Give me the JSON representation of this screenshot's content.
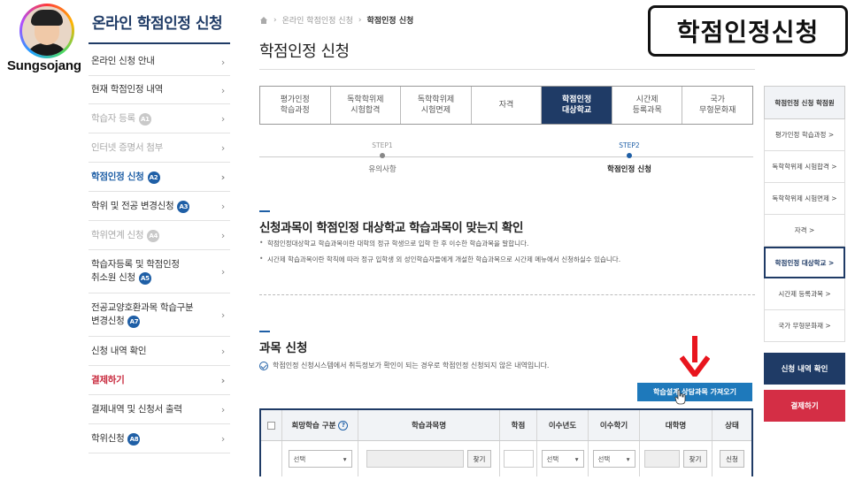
{
  "overlay": {
    "brand": "Sungsojang",
    "caption": "학점인정신청"
  },
  "sidebar": {
    "title": "온라인 학점인정 신청",
    "items": [
      {
        "label": "온라인 신청 안내",
        "badge": "",
        "state": "normal"
      },
      {
        "label": "현재 학점인정 내역",
        "badge": "",
        "state": "normal"
      },
      {
        "label": "학습자 등록",
        "badge": "A1",
        "state": "muted"
      },
      {
        "label": "인터넷 증명서 첨부",
        "badge": "",
        "state": "muted"
      },
      {
        "label": "학점인정 신청",
        "badge": "A2",
        "state": "active"
      },
      {
        "label": "학위 및 전공 변경신청",
        "badge": "A3",
        "state": "normal"
      },
      {
        "label": "학위연계 신청",
        "badge": "A4",
        "state": "muted"
      },
      {
        "label": "학습자등록 및 학점인정",
        "label2": "취소원 신청",
        "badge": "A5",
        "state": "normal"
      },
      {
        "label": "전공교양호환과목 학습구분",
        "label2": "변경신청",
        "badge": "A7",
        "state": "normal"
      },
      {
        "label": "신청 내역 확인",
        "badge": "",
        "state": "normal"
      },
      {
        "label": "결제하기",
        "badge": "",
        "state": "pay"
      },
      {
        "label": "결제내역 및 신청서 출력",
        "badge": "",
        "state": "normal"
      },
      {
        "label": "학위신청",
        "badge": "A8",
        "state": "normal"
      }
    ]
  },
  "breadcrumb": {
    "items": [
      "온라인 학점인정 신청",
      "학점인정 신청"
    ]
  },
  "page_title": "학점인정 신청",
  "tabs": [
    {
      "label": "평가인정\n학습과정",
      "active": false
    },
    {
      "label": "독학학위제\n시험합격",
      "active": false
    },
    {
      "label": "독학학위제\n시험면제",
      "active": false
    },
    {
      "label": "자격",
      "active": false
    },
    {
      "label": "학점인정\n대상학교",
      "active": true
    },
    {
      "label": "시간제\n등록과목",
      "active": false
    },
    {
      "label": "국가\n무형문화재",
      "active": false
    }
  ],
  "steps": [
    {
      "num": "STEP1",
      "label": "유의사항"
    },
    {
      "num": "STEP2",
      "label": "학점인정 신청"
    }
  ],
  "section1": {
    "title": "신청과목이 학점인정 대상학교 학습과목이 맞는지 확인",
    "bullets": [
      "학점인정대상학교 학습과목이란 대학의 정규 학생으로 입학 한 후 이수한 학습과목을 말합니다.",
      "시간제 학습과목이란 학칙에 따라 정규 입학생 외 성인학습자들에게 개설한 학습과목으로 시간제 메뉴에서 신청하실수 있습니다."
    ]
  },
  "section2": {
    "title": "과목 신청",
    "note": "학점인정 신청시스템에서 취득정보가 확인이 되는 경우로 학점인정 신청되지 않은 내역입니다.",
    "fetch_button": "학습설계 상담과목 가져오기"
  },
  "table": {
    "headers": [
      "희망학습 구분",
      "학습과목명",
      "학점",
      "이수년도",
      "이수학기",
      "대학명",
      "상태"
    ],
    "help": "?",
    "row": {
      "select_placeholder": "선택",
      "find_label": "찾기",
      "apply_label": "신청"
    }
  },
  "right_menu": {
    "head": "학점인정 신청 학점원",
    "items": [
      {
        "label": "평가인정 학습과정 >",
        "active": false
      },
      {
        "label": "독학학위제 시험합격 >",
        "active": false
      },
      {
        "label": "독학학위제 시험면제 >",
        "active": false
      },
      {
        "label": "자격 >",
        "active": false
      },
      {
        "label": "학점인정 대상학교 >",
        "active": true
      },
      {
        "label": "시간제 등록과목 >",
        "active": false
      },
      {
        "label": "국가 무형문화재 >",
        "active": false
      }
    ],
    "check_button": "신청 내역 확인",
    "pay_button": "결제하기"
  }
}
